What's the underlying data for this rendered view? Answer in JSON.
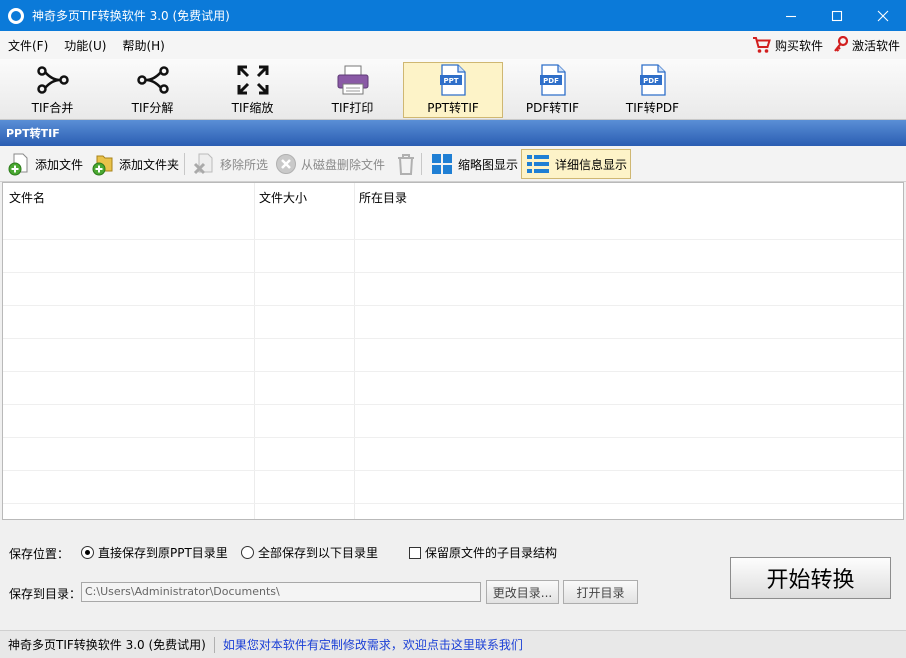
{
  "window": {
    "title": "神奇多页TIF转换软件 3.0 (免费试用)"
  },
  "menu": {
    "items": [
      "文件(F)",
      "功能(U)",
      "帮助(H)"
    ],
    "buy_label": "购买软件",
    "activate_label": "激活软件"
  },
  "toolbar": {
    "tools": [
      {
        "label": "TIF合并",
        "icon": "merge-icon"
      },
      {
        "label": "TIF分解",
        "icon": "split-icon"
      },
      {
        "label": "TIF缩放",
        "icon": "resize-icon"
      },
      {
        "label": "TIF打印",
        "icon": "printer-icon"
      },
      {
        "label": "PPT转TIF",
        "icon": "ppt-file-icon",
        "badge": "PPT",
        "active": true
      },
      {
        "label": "PDF转TIF",
        "icon": "pdf-file-icon",
        "badge": "PDF"
      },
      {
        "label": "TIF转PDF",
        "icon": "pdf-file-icon",
        "badge": "PDF"
      }
    ]
  },
  "section": {
    "title": "PPT转TIF"
  },
  "subtoolbar": {
    "add_file": "添加文件",
    "add_folder": "添加文件夹",
    "remove_selected": "移除所选",
    "delete_from_disk": "从磁盘删除文件",
    "thumbnail_view": "缩略图显示",
    "detail_view": "详细信息显示"
  },
  "list": {
    "columns": [
      "文件名",
      "文件大小",
      "所在目录"
    ]
  },
  "save": {
    "location_label": "保存位置：",
    "option_original": "直接保存到原PPT目录里",
    "option_all": "全部保存到以下目录里",
    "keep_structure": "保留原文件的子目录结构",
    "dir_label": "保存到目录：",
    "dir_value": "C:\\Users\\Administrator\\Documents\\",
    "change_dir": "更改目录...",
    "open_dir": "打开目录",
    "start": "开始转换"
  },
  "status": {
    "app": "神奇多页TIF转换软件 3.0 (免费试用)",
    "link": "如果您对本软件有定制修改需求，欢迎点击这里联系我们"
  },
  "colors": {
    "titlebar": "#0b7ad9",
    "section": "#2a5db2",
    "link": "#1a3fd6",
    "active_tool": "#fdf3c8"
  }
}
